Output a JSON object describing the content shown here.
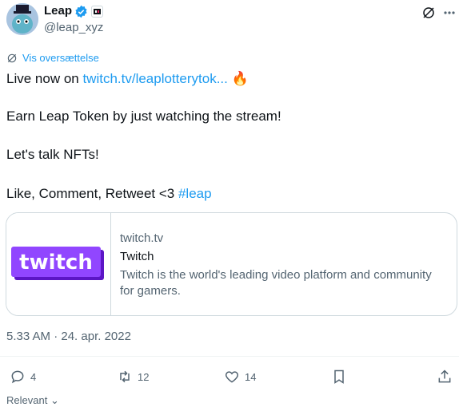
{
  "author": {
    "name": "Leap",
    "handle": "@leap_xyz"
  },
  "translate_label": "Vis oversættelse",
  "tweet": {
    "line1_prefix": "Live now on ",
    "line1_link": "twitch.tv/leaplotterytok...",
    "line1_emoji": "🔥",
    "line2": "Earn Leap Token by just watching the stream!",
    "line3": "Let's talk NFTs!",
    "line4_prefix": "Like, Comment, Retweet <3 ",
    "line4_hashtag": "#leap"
  },
  "card": {
    "logo_text": "twitch",
    "domain": "twitch.tv",
    "title": "Twitch",
    "description": "Twitch is the world's leading video platform and community for gamers."
  },
  "timestamp": "5.33 AM · 24. apr. 2022",
  "actions": {
    "replies": "4",
    "retweets": "12",
    "likes": "14"
  },
  "sort_label": "Relevant",
  "colors": {
    "accent": "#1d9bf0",
    "twitch_purple": "#9146ff",
    "text_primary": "#0f1419",
    "text_secondary": "#536471"
  }
}
